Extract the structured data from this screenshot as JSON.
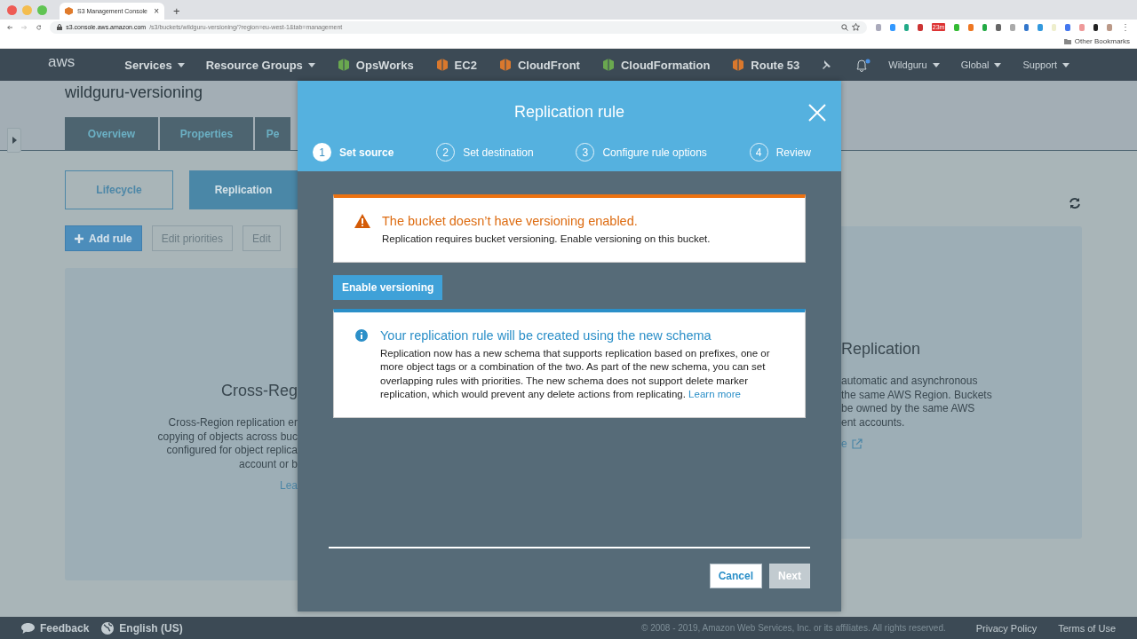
{
  "browser": {
    "tab_title": "S3 Management Console",
    "tab_close": "×",
    "new_tab": "+",
    "url_host": "s3.console.aws.amazon.com",
    "url_path": "/s3/buckets/wildguru-versioning/?region=eu-west-1&tab=management",
    "extension_badge": "23m",
    "bookmarks_label": "Other Bookmarks",
    "menu": "⋮"
  },
  "nav": {
    "logo": "aws",
    "items": [
      {
        "label": "Services",
        "kind": "menu"
      },
      {
        "label": "Resource Groups",
        "kind": "menu"
      },
      {
        "label": "OpsWorks",
        "kind": "service",
        "color": "#6aa84f"
      },
      {
        "label": "EC2",
        "kind": "service",
        "color": "#d9782d"
      },
      {
        "label": "CloudFront",
        "kind": "service",
        "color": "#d9782d"
      },
      {
        "label": "CloudFormation",
        "kind": "service",
        "color": "#6aa84f"
      },
      {
        "label": "Route 53",
        "kind": "service",
        "color": "#d9782d"
      }
    ],
    "account": [
      {
        "label": "Wildguru"
      },
      {
        "label": "Global"
      },
      {
        "label": "Support"
      }
    ]
  },
  "page": {
    "bucket_title": "wildguru-versioning",
    "tabs": [
      {
        "label": "Overview",
        "selected": false
      },
      {
        "label": "Properties",
        "selected": false
      },
      {
        "label": "Pe",
        "selected": false
      }
    ],
    "subtabs": [
      {
        "label": "Lifecycle",
        "selected": false
      },
      {
        "label": "Replication",
        "selected": true
      }
    ],
    "actions": [
      {
        "label": "Add rule",
        "disabled": false
      },
      {
        "label": "Edit priorities",
        "disabled": true
      },
      {
        "label": "Edit",
        "disabled": true
      }
    ],
    "left_card": {
      "title": "Cross-Reg",
      "lines": [
        "Cross-Region replication er",
        "copying of objects across buc",
        "configured for object replica",
        "account or b"
      ],
      "link": "Lea"
    },
    "right_card": {
      "title": "Replication",
      "lines": [
        "automatic and asynchronous",
        "the same AWS Region. Buckets",
        "be owned by the same AWS",
        "ent accounts."
      ],
      "link": "e"
    }
  },
  "modal": {
    "title": "Replication rule",
    "steps": [
      {
        "number": "1",
        "label": "Set source",
        "selected": true
      },
      {
        "number": "2",
        "label": "Set destination",
        "selected": false
      },
      {
        "number": "3",
        "label": "Configure rule options",
        "selected": false
      },
      {
        "number": "4",
        "label": "Review",
        "selected": false
      }
    ],
    "warning": {
      "title": "The bucket doesn’t have versioning enabled.",
      "text": "Replication requires bucket versioning. Enable versioning on this bucket."
    },
    "enable_button": "Enable versioning",
    "info": {
      "title": "Your replication rule will be created using the new schema",
      "text": "Replication now has a new schema that supports replication based on prefixes, one or more object tags or a combination of the two. As part of the new schema, you can set overlapping rules with priorities. The new schema does not support delete marker replication, which would prevent any delete actions from replicating.",
      "link": "Learn more"
    },
    "cancel": {
      "label": "Cancel",
      "disabled": false
    },
    "next": {
      "label": "Next",
      "disabled": true
    }
  },
  "footer": {
    "feedback": "Feedback",
    "language": "English (US)",
    "copyright": "© 2008 - 2019, Amazon Web Services, Inc. or its affiliates. All rights reserved.",
    "links": [
      "Privacy Policy",
      "Terms of Use"
    ]
  }
}
